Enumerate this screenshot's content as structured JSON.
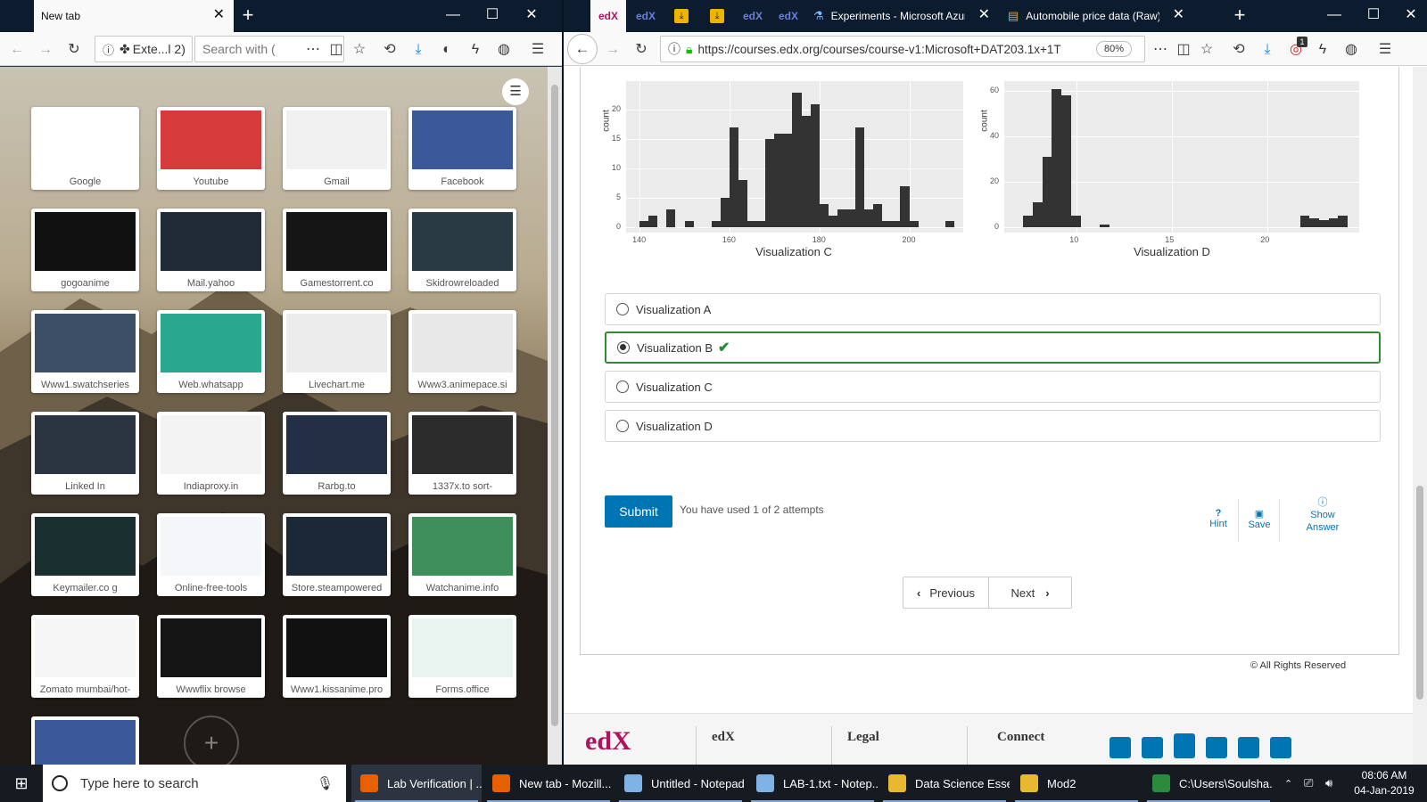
{
  "left_window": {
    "tab_title": "New tab",
    "url_text": "Exte...l 2)",
    "search_placeholder": "Search with (",
    "tiles": [
      {
        "label": "Google",
        "color": "#ffffff"
      },
      {
        "label": "Youtube",
        "color": "#d63a3a"
      },
      {
        "label": "Gmail",
        "color": "#f0f0f0"
      },
      {
        "label": "Facebook",
        "color": "#3b5998"
      },
      {
        "label": "gogoanime",
        "color": "#111111"
      },
      {
        "label": "Mail.yahoo",
        "color": "#1f2a36"
      },
      {
        "label": "Gamestorrent.co",
        "color": "#151515"
      },
      {
        "label": "Skidrowreloaded",
        "color": "#2a3a44"
      },
      {
        "label": "Www1.swatchseries",
        "color": "#3d4f66"
      },
      {
        "label": "Web.whatsapp",
        "color": "#2aa88f"
      },
      {
        "label": "Livechart.me",
        "color": "#ececec"
      },
      {
        "label": "Www3.animepace.si",
        "color": "#e8e8e8"
      },
      {
        "label": "Linked In",
        "color": "#2b3441"
      },
      {
        "label": "Indiaproxy.in",
        "color": "#f3f3f3"
      },
      {
        "label": "Rarbg.to",
        "color": "#222f45"
      },
      {
        "label": "1337x.to sort-",
        "color": "#2c2c2c"
      },
      {
        "label": "Keymailer.co g",
        "color": "#1a2f30"
      },
      {
        "label": "Online-free-tools",
        "color": "#f4f6fa"
      },
      {
        "label": "Store.steampowered",
        "color": "#1b2838"
      },
      {
        "label": "Watchanime.info",
        "color": "#3f8f5a"
      },
      {
        "label": "Zomato mumbai/hot-",
        "color": "#f6f6f6"
      },
      {
        "label": "Wwwflix browse",
        "color": "#141414"
      },
      {
        "label": "Www1.kissanime.pro",
        "color": "#111111"
      },
      {
        "label": "Forms.office",
        "color": "#e9f3ef"
      },
      {
        "label": "",
        "color": "#3b5998"
      }
    ]
  },
  "right_window": {
    "tabs": [
      {
        "label": "edX",
        "kind": "edx"
      },
      {
        "label": "edX",
        "kind": "edx"
      },
      {
        "label": "",
        "kind": "download"
      },
      {
        "label": "",
        "kind": "download"
      },
      {
        "label": "edX",
        "kind": "edx"
      },
      {
        "label": "edX",
        "kind": "edx"
      },
      {
        "label": "Experiments - Microsoft Azure M",
        "kind": "flask"
      },
      {
        "label": "Automobile price data (Raw) R",
        "kind": "book"
      }
    ],
    "url": "https://courses.edx.org/courses/course-v1:Microsoft+DAT203.1x+1T",
    "zoom": "80%",
    "badge_count": "1",
    "choices": [
      {
        "label": "Visualization A",
        "selected": false,
        "correct": false
      },
      {
        "label": "Visualization B",
        "selected": true,
        "correct": true
      },
      {
        "label": "Visualization C",
        "selected": false,
        "correct": false
      },
      {
        "label": "Visualization D",
        "selected": false,
        "correct": false
      }
    ],
    "submit_label": "Submit",
    "attempts_text": "You have used 1 of 2 attempts",
    "hint_label": "Hint",
    "save_label": "Save",
    "show_answer_label": "Show Answer",
    "previous_label": "Previous",
    "next_label": "Next",
    "copyright": "© All Rights Reserved",
    "footer": {
      "logo": "edX",
      "col1": "edX",
      "col2": "Legal",
      "col3": "Connect"
    }
  },
  "taskbar": {
    "search_placeholder": "Type here to search",
    "items": [
      {
        "label": "Lab Verification | ...",
        "color": "#e66000"
      },
      {
        "label": "New tab - Mozill...",
        "color": "#e66000"
      },
      {
        "label": "Untitled - Notepad",
        "color": "#7fb2e5"
      },
      {
        "label": "LAB-1.txt - Notep...",
        "color": "#7fb2e5"
      },
      {
        "label": "Data Science Esse...",
        "color": "#e8b930"
      },
      {
        "label": "Mod2",
        "color": "#e8b930"
      },
      {
        "label": "C:\\Users\\Soulsha...",
        "color": "#2b8a3e"
      }
    ],
    "time": "08:06 AM",
    "date": "04-Jan-2019"
  },
  "chart_data": [
    {
      "type": "bar",
      "title": "Visualization C",
      "ylabel": "count",
      "x_ticks": [
        140,
        160,
        180,
        200
      ],
      "y_ticks": [
        0,
        5,
        10,
        15,
        20
      ],
      "xlim": [
        137,
        212
      ],
      "ylim": [
        0,
        24
      ],
      "grid": true,
      "bins": [
        {
          "x": 140,
          "y": 1
        },
        {
          "x": 142,
          "y": 2
        },
        {
          "x": 146,
          "y": 3
        },
        {
          "x": 150,
          "y": 1
        },
        {
          "x": 156,
          "y": 1
        },
        {
          "x": 158,
          "y": 5
        },
        {
          "x": 160,
          "y": 17
        },
        {
          "x": 162,
          "y": 8
        },
        {
          "x": 164,
          "y": 1
        },
        {
          "x": 166,
          "y": 1
        },
        {
          "x": 168,
          "y": 15
        },
        {
          "x": 170,
          "y": 16
        },
        {
          "x": 172,
          "y": 16
        },
        {
          "x": 174,
          "y": 23
        },
        {
          "x": 176,
          "y": 19
        },
        {
          "x": 178,
          "y": 21
        },
        {
          "x": 180,
          "y": 4
        },
        {
          "x": 182,
          "y": 2
        },
        {
          "x": 184,
          "y": 3
        },
        {
          "x": 186,
          "y": 3
        },
        {
          "x": 188,
          "y": 17
        },
        {
          "x": 190,
          "y": 3
        },
        {
          "x": 192,
          "y": 4
        },
        {
          "x": 194,
          "y": 1
        },
        {
          "x": 196,
          "y": 1
        },
        {
          "x": 198,
          "y": 7
        },
        {
          "x": 200,
          "y": 1
        },
        {
          "x": 208,
          "y": 1
        }
      ]
    },
    {
      "type": "bar",
      "title": "Visualization D",
      "ylabel": "count",
      "x_ticks": [
        10,
        15,
        20
      ],
      "y_ticks": [
        0,
        20,
        40,
        60
      ],
      "xlim": [
        6.2,
        24.8
      ],
      "ylim": [
        0,
        62
      ],
      "grid": true,
      "bins": [
        {
          "x": 7.2,
          "y": 5
        },
        {
          "x": 7.7,
          "y": 11
        },
        {
          "x": 8.2,
          "y": 31
        },
        {
          "x": 8.7,
          "y": 61
        },
        {
          "x": 9.2,
          "y": 58
        },
        {
          "x": 9.7,
          "y": 5
        },
        {
          "x": 11.2,
          "y": 1
        },
        {
          "x": 21.7,
          "y": 5
        },
        {
          "x": 22.2,
          "y": 4
        },
        {
          "x": 22.7,
          "y": 3
        },
        {
          "x": 23.2,
          "y": 4
        },
        {
          "x": 23.7,
          "y": 5
        }
      ]
    }
  ]
}
